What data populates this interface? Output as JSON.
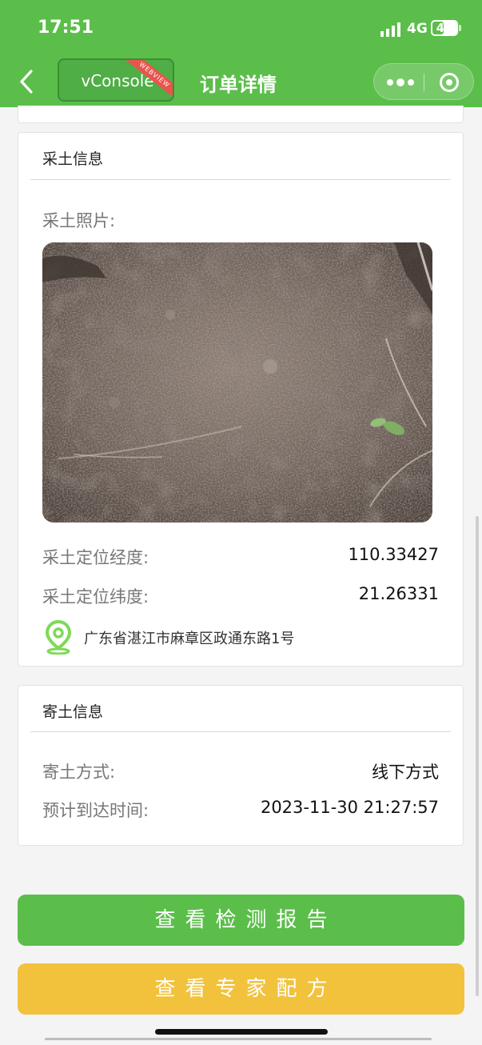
{
  "status_bar": {
    "time": "17:51",
    "network": "4G",
    "battery": "46",
    "battery_level": 0.46
  },
  "nav": {
    "vconsole_label": "vConsole",
    "webview_ribbon": "WEBVIEW",
    "title": "订单详情"
  },
  "sampling": {
    "title": "采土信息",
    "photo_label": "采土照片:",
    "longitude_label": "采土定位经度:",
    "longitude_value": "110.33427",
    "latitude_label": "采土定位纬度:",
    "latitude_value": "21.26331",
    "address": "广东省湛江市麻章区政通东路1号"
  },
  "shipping": {
    "title": "寄土信息",
    "method_label": "寄土方式:",
    "method_value": "线下方式",
    "eta_label": "预计到达时间:",
    "eta_value": "2023-11-30 21:27:57"
  },
  "buttons": {
    "report": "查看检测报告",
    "formula": "查看专家配方"
  },
  "colors": {
    "brand_green": "#5bbe4a",
    "button_yellow": "#f2c23c",
    "location_icon": "#7ed957"
  },
  "icons": {
    "back": "chevron-left-icon",
    "more": "more-dots-icon",
    "close": "target-close-icon",
    "location": "map-pin-icon",
    "signal": "signal-bars-icon",
    "battery": "battery-icon"
  }
}
